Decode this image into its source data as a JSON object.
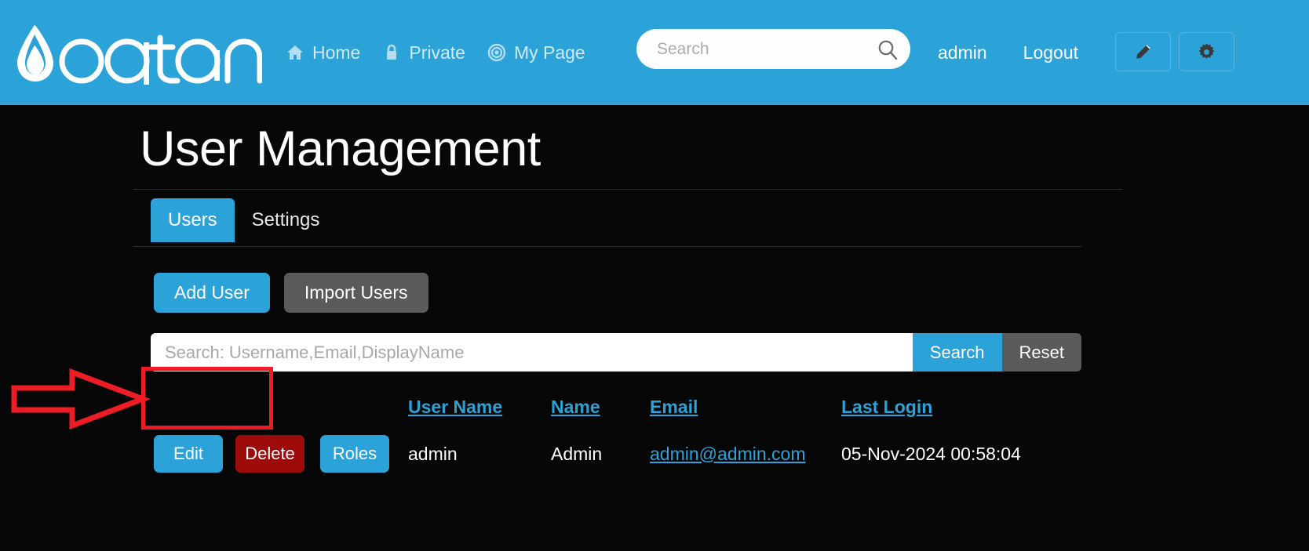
{
  "header": {
    "brand": "oqtane",
    "nav": [
      {
        "label": "Home",
        "icon": "home-icon"
      },
      {
        "label": "Private",
        "icon": "lock-icon"
      },
      {
        "label": "My Page",
        "icon": "target-icon"
      }
    ],
    "search": {
      "placeholder": "Search",
      "value": "",
      "icon": "search-icon"
    },
    "user": "admin",
    "logout": "Logout",
    "edit_icon": "pencil-icon",
    "settings_icon": "gear-icon",
    "bg_color": "#2BA2D8"
  },
  "main": {
    "title": "User Management",
    "tabs": [
      {
        "label": "Users",
        "active": true
      },
      {
        "label": "Settings",
        "active": false
      }
    ],
    "actions": [
      {
        "label": "Add User",
        "style": "primary",
        "highlighted": true
      },
      {
        "label": "Import Users",
        "style": "secondary",
        "highlighted": false
      }
    ],
    "filter": {
      "placeholder": "Search: Username,Email,DisplayName",
      "value": "",
      "search_label": "Search",
      "reset_label": "Reset"
    },
    "table": {
      "columns": [
        "",
        "",
        "",
        "User Name",
        "Name",
        "Email",
        "Last Login"
      ],
      "rows": [
        {
          "edit_label": "Edit",
          "delete_label": "Delete",
          "roles_label": "Roles",
          "username": "admin",
          "name": "Admin",
          "email": "admin@admin.com",
          "last_login": "05-Nov-2024 00:58:04"
        }
      ]
    }
  },
  "annotation": {
    "arrow": "right-arrow-outline",
    "highlight_color": "#ee1c25"
  },
  "colors": {
    "accent": "#2BA2D8",
    "background": "#070707",
    "danger": "#9e0b0b",
    "secondary": "#5a5a5a"
  }
}
